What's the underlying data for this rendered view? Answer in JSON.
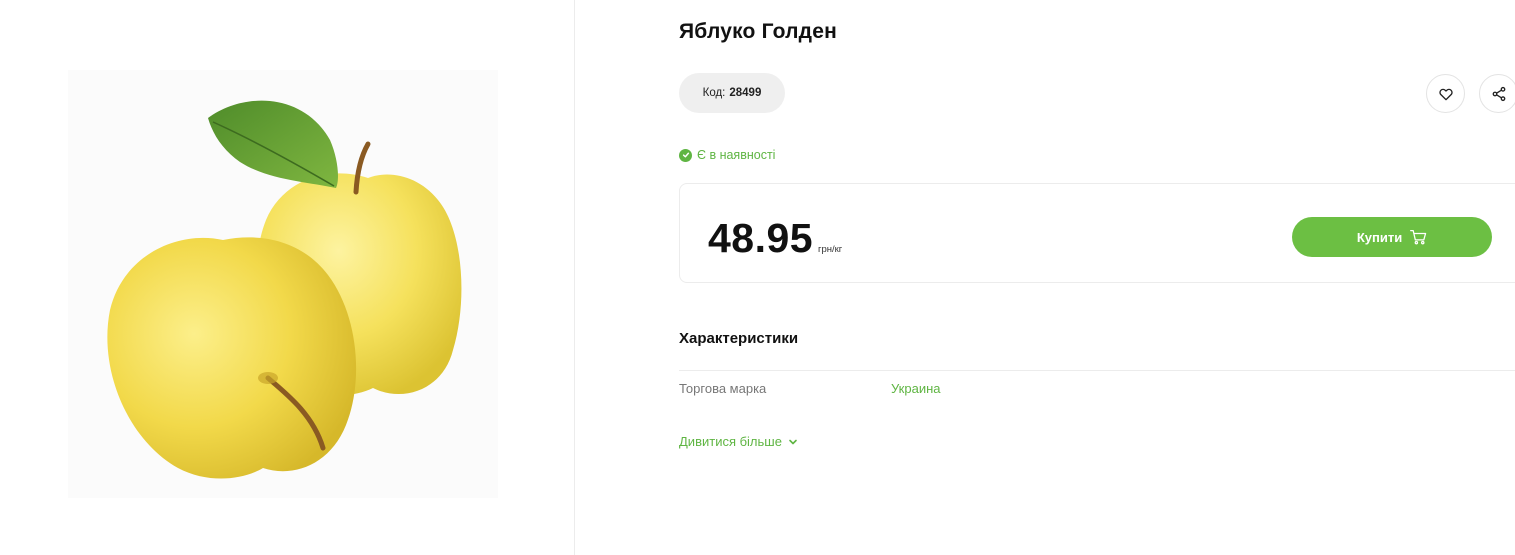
{
  "product": {
    "title": "Яблуко Голден",
    "code_label": "Код:",
    "code_value": "28499",
    "stock_status": "Є в наявності",
    "price": "48.95",
    "price_unit": "грн/кг",
    "buy_label": "Купити"
  },
  "characteristics": {
    "section_title": "Характеристики",
    "rows": [
      {
        "label": "Торгова марка",
        "value": "Украина"
      }
    ],
    "more_label": "Дивитися більше"
  },
  "icons": {
    "favorite": "heart-icon",
    "share": "share-icon",
    "stock": "check-circle-icon",
    "cart": "cart-icon",
    "more": "chevron-down-icon"
  },
  "colors": {
    "accent_green": "#6cbf43",
    "stock_green": "#5fb543",
    "text": "#111111",
    "pill_bg": "#efefef",
    "border": "#ececec"
  }
}
